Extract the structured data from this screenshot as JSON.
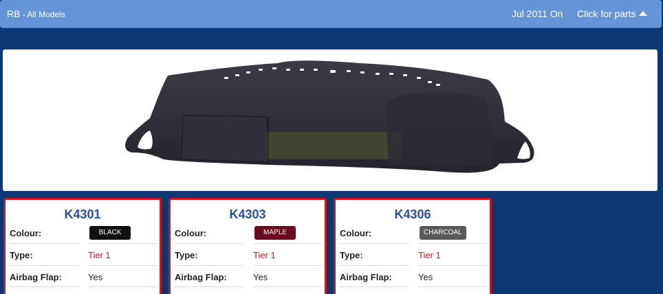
{
  "header": {
    "model": "RB",
    "model_sub": " - All Models",
    "date": "Jul 2011 On",
    "parts_label": "Click for parts",
    "bar_color": "#6495d6"
  },
  "labels": {
    "colour": "Colour:",
    "type": "Type:",
    "airbag": "Airbag Flap:"
  },
  "products": [
    {
      "code": "K4301",
      "colour": "BLACK",
      "colour_hex": "#111111",
      "type": "Tier 1",
      "airbag": "Yes"
    },
    {
      "code": "K4303",
      "colour": "MAPLE",
      "colour_hex": "#6b0a1e",
      "type": "Tier 1",
      "airbag": "Yes"
    },
    {
      "code": "K4306",
      "colour": "CHARCOAL",
      "colour_hex": "#5a5a5a",
      "type": "Tier 1",
      "airbag": "Yes"
    }
  ],
  "colors": {
    "page_bg": "#0b3774",
    "card_border": "#d0141d",
    "code_text": "#2a4f9a",
    "tier_text": "#d0141d"
  }
}
